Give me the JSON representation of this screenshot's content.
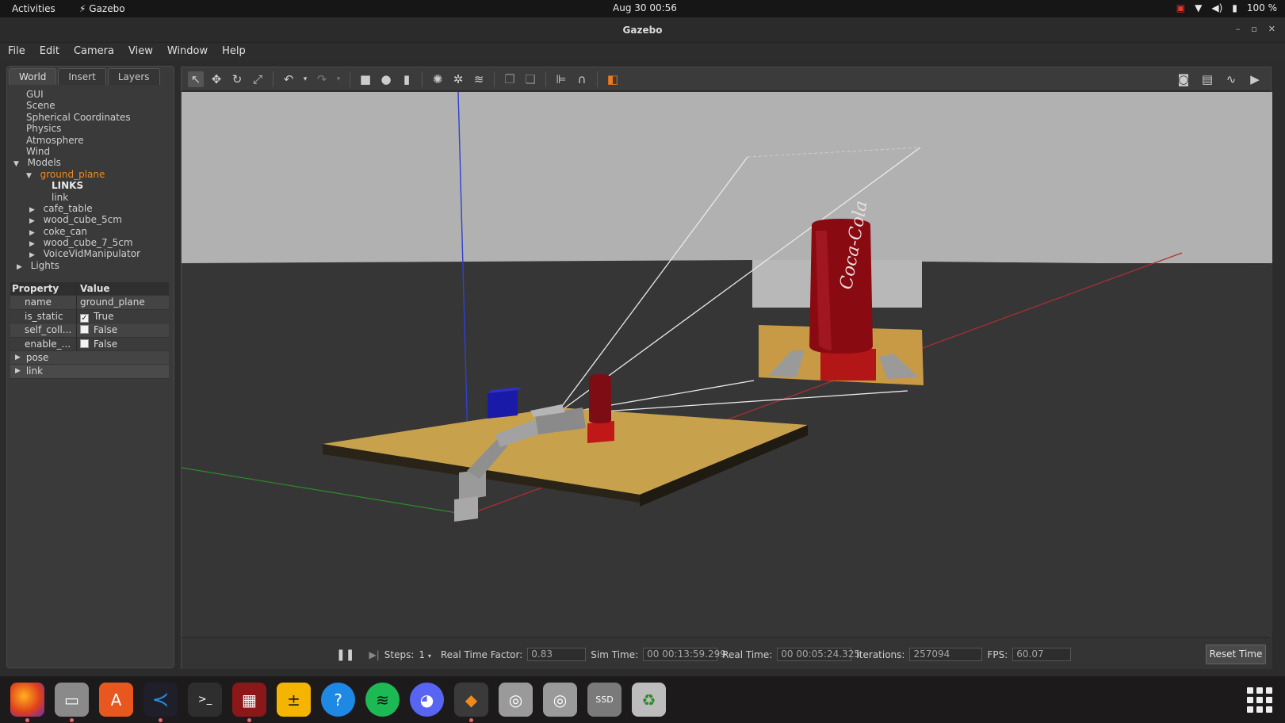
{
  "topbar": {
    "activities": "Activities",
    "app_name": "Gazebo",
    "clock": "Aug 30  00:56",
    "battery": "100 %"
  },
  "window": {
    "title": "Gazebo"
  },
  "menu": [
    "File",
    "Edit",
    "Camera",
    "View",
    "Window",
    "Help"
  ],
  "left_tabs": [
    "World",
    "Insert",
    "Layers"
  ],
  "tree": {
    "gui": "GUI",
    "scene": "Scene",
    "spherical": "Spherical Coordinates",
    "physics": "Physics",
    "atmosphere": "Atmosphere",
    "wind": "Wind",
    "models": "Models",
    "ground_plane": "ground_plane",
    "links": "LINKS",
    "link": "link",
    "cafe_table": "cafe_table",
    "wood_cube_5cm": "wood_cube_5cm",
    "coke_can": "coke_can",
    "wood_cube_7_5cm": "wood_cube_7_5cm",
    "voice": "VoiceVidManipulator",
    "lights": "Lights"
  },
  "properties": {
    "header_property": "Property",
    "header_value": "Value",
    "name_key": "name",
    "name_val": "ground_plane",
    "static_key": "is_static",
    "static_val": "True",
    "selfcoll_key": "self_coll...",
    "selfcoll_val": "False",
    "enable_key": "enable_...",
    "enable_val": "False",
    "pose": "pose",
    "link": "link"
  },
  "status": {
    "steps_label": "Steps:",
    "steps_value": "1",
    "rtf_label": "Real Time Factor:",
    "rtf_value": "0.83",
    "simtime_label": "Sim Time:",
    "simtime_value": "00 00:13:59.299",
    "realtime_label": "Real Time:",
    "realtime_value": "00 00:05:24.325",
    "iterations_label": "Iterations:",
    "iterations_value": "257094",
    "fps_label": "FPS:",
    "fps_value": "60.07",
    "reset_label": "Reset Time"
  },
  "scene_labels": {
    "can_logo": "Coca-Cola"
  },
  "dock_label_ssd": "SSD",
  "colors": {
    "selection": "#f08a1e",
    "sky": "#b0b0b0",
    "floor": "#363636",
    "table_top": "#c9a24b"
  }
}
